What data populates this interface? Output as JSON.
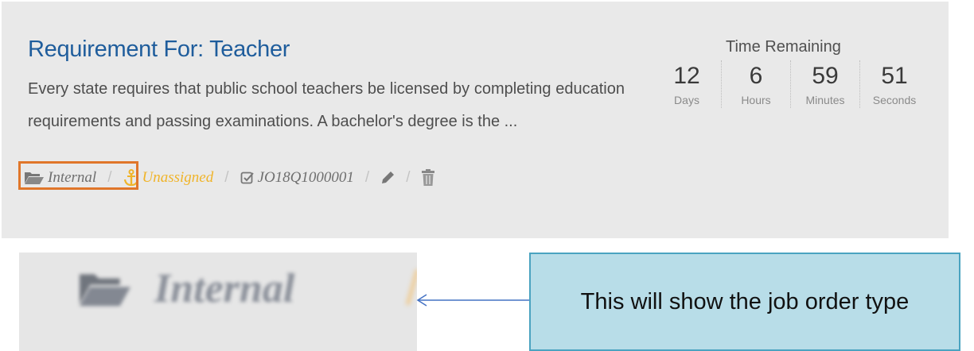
{
  "card": {
    "title": "Requirement For: Teacher",
    "description": "Every state requires that public school teachers be licensed by completing education requirements and passing examinations. A bachelor's degree is the ...",
    "meta": {
      "type_label": "Internal",
      "type_icon": "folder-open-icon",
      "assignee_label": "Unassigned",
      "assignee_icon": "anchor-icon",
      "job_id": "JO18Q1000001",
      "job_id_icon": "checkbox-icon",
      "edit_icon": "pencil-icon",
      "delete_icon": "trash-icon",
      "separator": "/"
    },
    "timer": {
      "label": "Time Remaining",
      "units": [
        {
          "value": "12",
          "label": "Days"
        },
        {
          "value": "6",
          "label": "Hours"
        },
        {
          "value": "59",
          "label": "Minutes"
        },
        {
          "value": "51",
          "label": "Seconds"
        }
      ]
    }
  },
  "zoom": {
    "label": "Internal",
    "icon": "folder-open-icon"
  },
  "callout": {
    "text": "This will show the job order type"
  },
  "colors": {
    "title": "#1f5d9c",
    "unassigned": "#f0b429",
    "highlight": "#e0762a",
    "callout_bg": "#b8dde8",
    "callout_border": "#4aa3c0"
  }
}
